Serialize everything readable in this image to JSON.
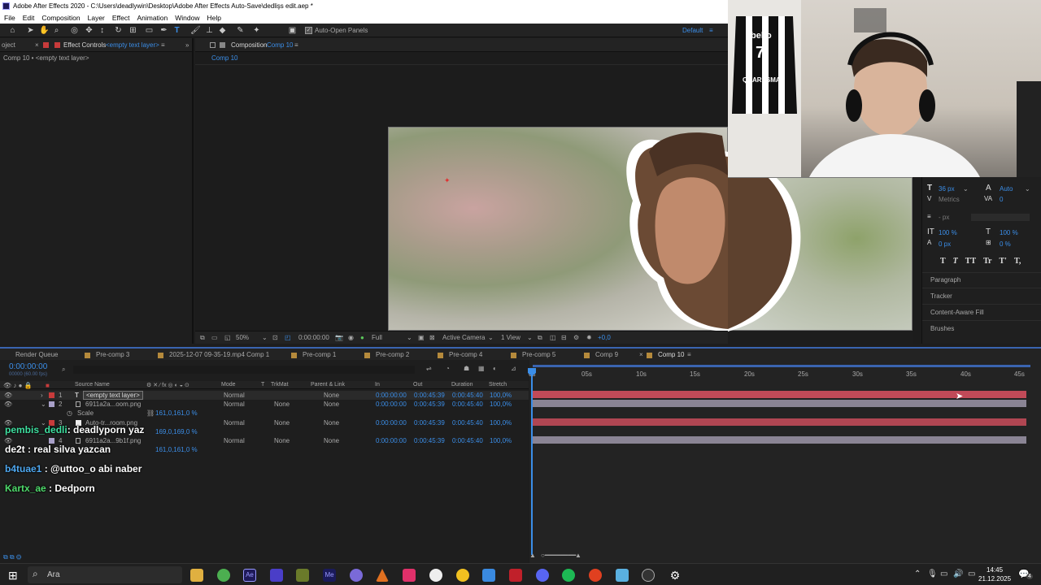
{
  "window": {
    "title": "Adobe After Effects 2020 - C:\\Users\\deadlywin\\Desktop\\Adobe After Effects Auto-Save\\dedlişs edit.aep *"
  },
  "menu": [
    "File",
    "Edit",
    "Composition",
    "Layer",
    "Effect",
    "Animation",
    "Window",
    "Help"
  ],
  "toolbar": {
    "auto_open": "Auto-Open Panels",
    "workspace": "Default"
  },
  "left_panel": {
    "tab_project": "oject",
    "tab_effect": "Effect Controls",
    "tab_effect_target": "<empty text layer>",
    "breadcrumb": "Comp 10 • <empty text layer>"
  },
  "comp_panel": {
    "tab": "Composition",
    "tab_name": "Comp 10",
    "sub_tab": "Comp 10"
  },
  "viewer": {
    "zoom": "50%",
    "time": "0:00:00:00",
    "quality": "Full",
    "camera": "Active Camera",
    "views": "1 View",
    "exposure": "+0,0"
  },
  "character_panel": {
    "font_size": "36 px",
    "leading": "Auto",
    "kerning": "Metrics",
    "tracking": "0",
    "stroke": "- px",
    "vscale": "100 %",
    "hscale": "100 %",
    "baseline": "0 px",
    "tsume": "0 %",
    "styles": [
      "T",
      "T",
      "TT",
      "Tr",
      "T'",
      "T,"
    ],
    "sections": [
      "Paragraph",
      "Tracker",
      "Content-Aware Fill",
      "Brushes"
    ]
  },
  "timeline_tabs": [
    "Render Queue",
    "Pre-comp 3",
    "2025-12-07 09-35-19.mp4 Comp 1",
    "Pre-comp 1",
    "Pre-comp 2",
    "Pre-comp 4",
    "Pre-comp 5",
    "Comp 9",
    "Comp 10"
  ],
  "timecode": "0:00:00:00",
  "timecode_sub": "00000 (60.00 fps)",
  "columns": {
    "source": "Source Name",
    "mode": "Mode",
    "t": "T",
    "trkmat": "TrkMat",
    "parent": "Parent & Link",
    "in": "In",
    "out": "Out",
    "duration": "Duration",
    "stretch": "Stretch"
  },
  "layers": [
    {
      "num": "1",
      "name": "<empty text layer>",
      "mode": "Normal",
      "trkmat": "",
      "parent": "None",
      "in": "0:00:00:00",
      "out": "0:00:45:39",
      "duration": "0:00:45:40",
      "stretch": "100,0%"
    },
    {
      "num": "2",
      "name": "6911a2a...oom.png",
      "mode": "Normal",
      "trkmat": "None",
      "parent": "None",
      "in": "0:00:00:00",
      "out": "0:00:45:39",
      "duration": "0:00:45:40",
      "stretch": "100,0%",
      "prop": "Scale",
      "prop_val": "161,0,161,0 %"
    },
    {
      "num": "3",
      "name": "Auto-tr...room.png",
      "mode": "Normal",
      "trkmat": "None",
      "parent": "None",
      "in": "0:00:00:00",
      "out": "0:00:45:39",
      "duration": "0:00:45:40",
      "stretch": "100,0%",
      "prop_val": "169,0,169,0 %"
    },
    {
      "num": "4",
      "name": "6911a2a...9b1f.png",
      "mode": "Normal",
      "trkmat": "None",
      "parent": "None",
      "in": "0:00:00:00",
      "out": "0:00:45:39",
      "duration": "0:00:45:40",
      "stretch": "100,0%",
      "prop_val": "161,0,161,0 %"
    }
  ],
  "ruler": [
    "0s",
    "05s",
    "10s",
    "15s",
    "20s",
    "25s",
    "30s",
    "35s",
    "40s",
    "45s"
  ],
  "chat": [
    {
      "user": "pembis_dedli",
      "msg": ": deadlyporn yaz",
      "user_color": "#3fe0a0"
    },
    {
      "user": "de2t",
      "msg": " : real silva yazcan",
      "user_color": "#ffffff"
    },
    {
      "user": "b4tuae1",
      "msg": " : @uttoo_o abi naber",
      "user_color": "#4fa8f0"
    },
    {
      "user": "Kartx_ae",
      "msg": " : Dedporn",
      "user_color": "#4fdc6c"
    }
  ],
  "webcam": {
    "jersey_text": "beko",
    "jersey_number": "7",
    "jersey_name": "QUARESMA"
  },
  "taskbar": {
    "search": "Ara",
    "time": "14:45",
    "date": "21.12.2025",
    "notifications": "4"
  }
}
